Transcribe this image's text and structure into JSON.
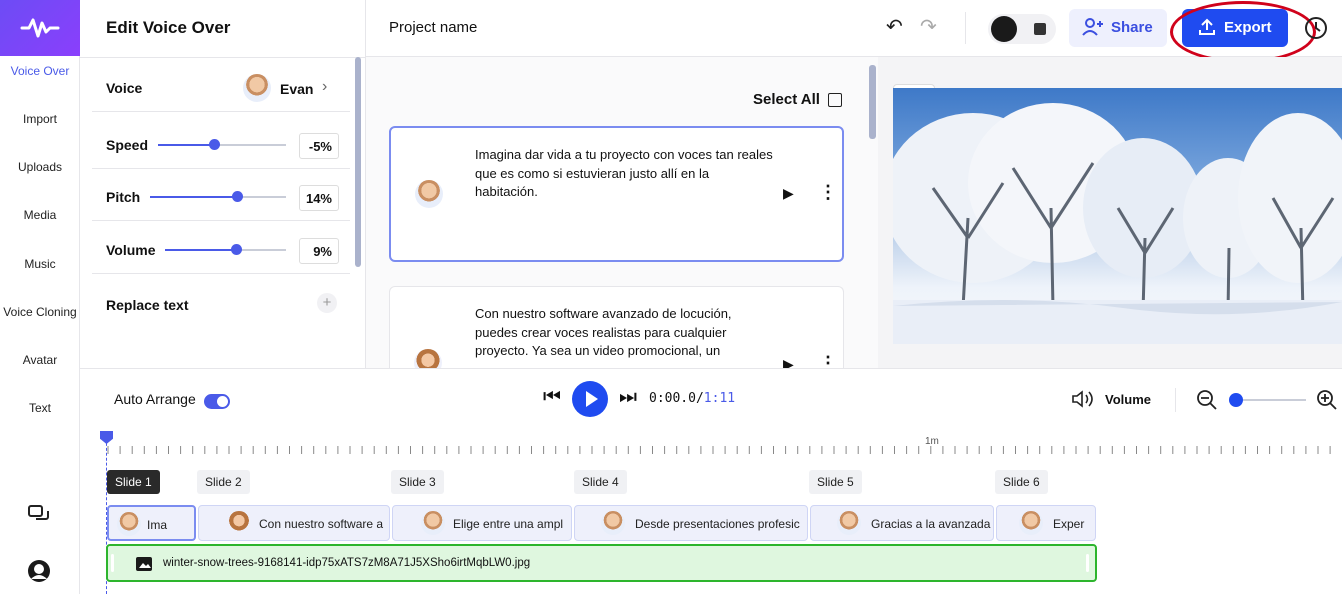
{
  "nav": {
    "items": [
      {
        "label": "Voice Over",
        "active": true
      },
      {
        "label": "Import"
      },
      {
        "label": "Uploads"
      },
      {
        "label": "Media"
      },
      {
        "label": "Music"
      },
      {
        "label": "Voice Cloning"
      },
      {
        "label": "Avatar"
      },
      {
        "label": "Text"
      }
    ]
  },
  "edit_panel": {
    "title": "Edit Voice Over",
    "voice_label": "Voice",
    "voice_name": "Evan",
    "speed_label": "Speed",
    "speed_value": "-5%",
    "pitch_label": "Pitch",
    "pitch_value": "14%",
    "volume_label": "Volume",
    "volume_value": "9%",
    "replace_text_label": "Replace text"
  },
  "header": {
    "project_name": "Project name",
    "share_label": "Share",
    "export_label": "Export"
  },
  "script": {
    "select_all_label": "Select All",
    "cards": [
      {
        "text": "Imagina dar vida a tu proyecto con voces tan reales que es como si estuvieran justo allí en la habitación."
      },
      {
        "text": "Con nuestro software avanzado de locución, puedes crear voces realistas para cualquier proyecto. Ya sea un video promocional, un"
      }
    ]
  },
  "playback": {
    "auto_arrange_label": "Auto Arrange",
    "current_time": "0:00.0",
    "separator": "/",
    "total_time": "1:11",
    "volume_label": "Volume",
    "ruler_mark": "1m"
  },
  "timeline": {
    "slides": [
      {
        "label": "Slide 1",
        "active": true,
        "clip_text": "Ima"
      },
      {
        "label": "Slide 2",
        "clip_text": "Con nuestro software a"
      },
      {
        "label": "Slide 3",
        "clip_text": "Elige entre una ampl"
      },
      {
        "label": "Slide 4",
        "clip_text": "Desde presentaciones profesic"
      },
      {
        "label": "Slide 5",
        "clip_text": "Gracias a la avanzada"
      },
      {
        "label": "Slide 6",
        "clip_text": "Exper"
      }
    ],
    "media_file": "winter-snow-trees-9168141-idp75xATS7zM8A71J5XSho6irtMqbLW0.jpg"
  },
  "colors": {
    "accent": "#4a5ae8",
    "export_button": "#1f4bf0",
    "highlight_circle": "#d0021b",
    "media_track": "#dff7df"
  }
}
